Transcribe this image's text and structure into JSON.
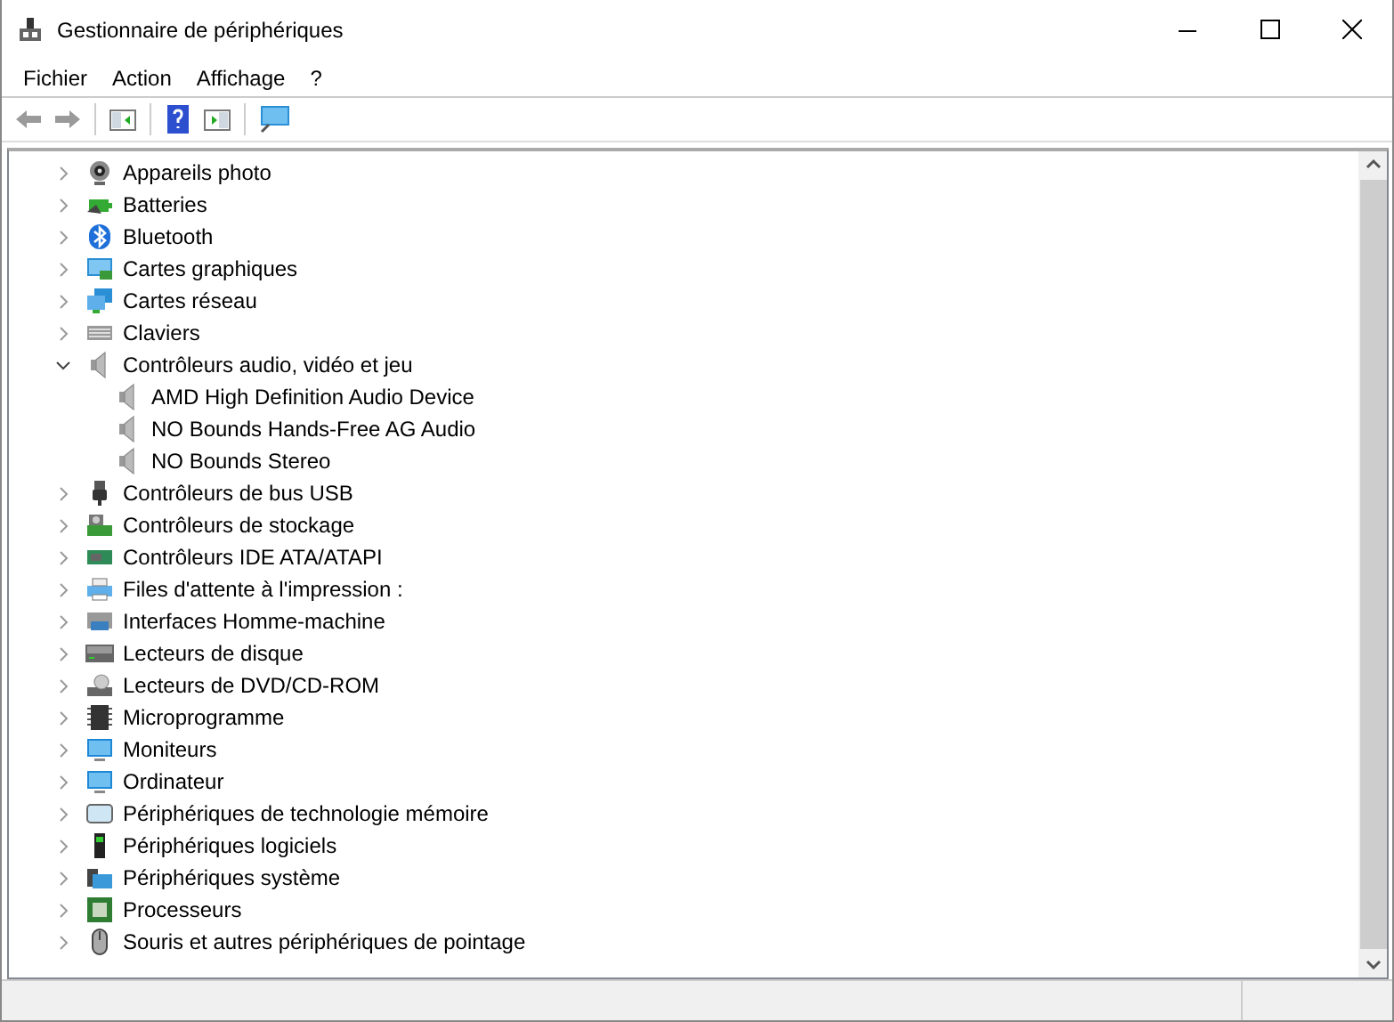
{
  "window": {
    "title": "Gestionnaire de périphériques"
  },
  "menu": [
    "Fichier",
    "Action",
    "Affichage",
    "?"
  ],
  "tree": [
    {
      "label": "Appareils photo",
      "expanded": false
    },
    {
      "label": "Batteries",
      "expanded": false
    },
    {
      "label": "Bluetooth",
      "expanded": false
    },
    {
      "label": "Cartes graphiques",
      "expanded": false
    },
    {
      "label": "Cartes réseau",
      "expanded": false
    },
    {
      "label": "Claviers",
      "expanded": false
    },
    {
      "label": "Contrôleurs audio, vidéo et jeu",
      "expanded": true,
      "children": [
        {
          "label": "AMD High Definition Audio Device"
        },
        {
          "label": "NO Bounds Hands-Free AG Audio"
        },
        {
          "label": "NO Bounds Stereo"
        }
      ]
    },
    {
      "label": "Contrôleurs de bus USB",
      "expanded": false
    },
    {
      "label": "Contrôleurs de stockage",
      "expanded": false
    },
    {
      "label": "Contrôleurs IDE ATA/ATAPI",
      "expanded": false
    },
    {
      "label": "Files d'attente à l'impression :",
      "expanded": false
    },
    {
      "label": "Interfaces Homme-machine",
      "expanded": false
    },
    {
      "label": "Lecteurs de disque",
      "expanded": false
    },
    {
      "label": "Lecteurs de DVD/CD-ROM",
      "expanded": false
    },
    {
      "label": "Microprogramme",
      "expanded": false
    },
    {
      "label": "Moniteurs",
      "expanded": false
    },
    {
      "label": "Ordinateur",
      "expanded": false
    },
    {
      "label": "Périphériques de technologie mémoire",
      "expanded": false
    },
    {
      "label": "Périphériques logiciels",
      "expanded": false
    },
    {
      "label": "Périphériques système",
      "expanded": false
    },
    {
      "label": "Processeurs",
      "expanded": false
    },
    {
      "label": "Souris et autres périphériques de pointage",
      "expanded": false
    }
  ]
}
